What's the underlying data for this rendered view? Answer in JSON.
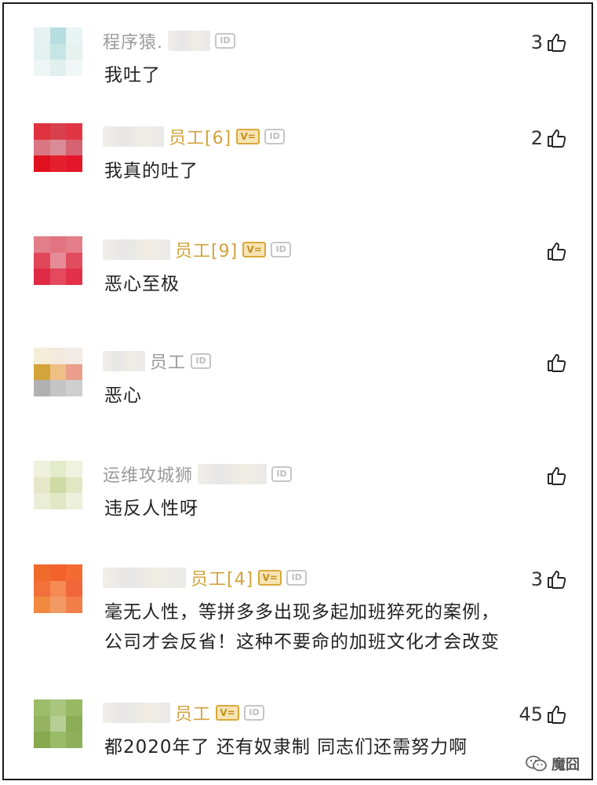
{
  "comments": [
    {
      "name": "程序猿.",
      "name_style": "gray",
      "pre_blur": false,
      "post_blur": true,
      "verified": false,
      "show_id": true,
      "likes": "3",
      "text": [
        "我吐了"
      ],
      "avatar_colors": [
        "#e6f2f2",
        "#b6dde0",
        "#e7f4f4",
        "#e3f2f1",
        "#c6e6e6",
        "#e6f2f0",
        "#eef6f5",
        "#dff0ee",
        "#f1f7f6"
      ]
    },
    {
      "name": "员工[6]",
      "name_style": "gold",
      "pre_blur": true,
      "post_blur": false,
      "verified": true,
      "show_id": true,
      "likes": "2",
      "text": [
        "我真的吐了"
      ],
      "avatar_colors": [
        "#e0313e",
        "#d9404d",
        "#e23544",
        "#d87682",
        "#d98b96",
        "#d56371",
        "#e0111f",
        "#e4202d",
        "#e4162a"
      ]
    },
    {
      "name": "员工[9]",
      "name_style": "gold",
      "pre_blur": true,
      "post_blur": false,
      "verified": true,
      "show_id": true,
      "likes": "",
      "text": [
        "恶心至极"
      ],
      "avatar_colors": [
        "#e27e89",
        "#e17480",
        "#e37d8a",
        "#e24759",
        "#e58c98",
        "#e14d5e",
        "#df2b43",
        "#e4495d",
        "#e23048"
      ]
    },
    {
      "name": "员工",
      "name_style": "gray",
      "pre_blur": true,
      "post_blur": false,
      "verified": false,
      "show_id": true,
      "likes": "",
      "text": [
        "恶心"
      ],
      "avatar_colors": [
        "#f4eed8",
        "#f3e9dd",
        "#f2ebe6",
        "#d3a439",
        "#efbf85",
        "#ea9e8b",
        "#b1b1b1",
        "#c5c5c5",
        "#cfcfcf"
      ]
    },
    {
      "name": "运维攻城狮",
      "name_style": "gray",
      "pre_blur": false,
      "post_blur": true,
      "verified": false,
      "show_id": true,
      "likes": "",
      "text": [
        "违反人性呀"
      ],
      "avatar_colors": [
        "#eef1dc",
        "#e4ebca",
        "#eff2de",
        "#e4e8c8",
        "#cfd9a4",
        "#e1e6c3",
        "#eaeed7",
        "#e2e7c6",
        "#edf0da"
      ]
    },
    {
      "name": "员工[4]",
      "name_style": "gold",
      "pre_blur": true,
      "post_blur": false,
      "verified": true,
      "show_id": true,
      "likes": "3",
      "text": [
        "毫无人性，等拼多多出现多起加班猝死的案例，",
        "公司才会反省！这种不要命的加班文化才会改变"
      ],
      "avatar_colors": [
        "#f06a2c",
        "#f3622a",
        "#f56a30",
        "#f2703a",
        "#f68a54",
        "#f1663a",
        "#f1893f",
        "#f19a63",
        "#f27e4a"
      ]
    },
    {
      "name": "员工",
      "name_style": "gold",
      "pre_blur": true,
      "post_blur": false,
      "verified": true,
      "show_id": true,
      "likes": "45",
      "text": [
        "都2020年了 还有奴隶制 同志们还需努力啊"
      ],
      "avatar_colors": [
        "#9cbd6a",
        "#a9c57e",
        "#98b864",
        "#94b461",
        "#b7cf95",
        "#8cae57",
        "#87a94f",
        "#9abb68",
        "#8fb05a"
      ]
    }
  ],
  "badges": {
    "verified_glyph": "V=",
    "id_glyph": "ID"
  },
  "icons": {
    "like": "thumbs-up-icon",
    "footer": "wechat-icon"
  },
  "footer": {
    "brand": "魔囧"
  },
  "colors": {
    "gold_name": "#d1a23d",
    "gray_name": "#9a9a9a",
    "text": "#222222"
  }
}
